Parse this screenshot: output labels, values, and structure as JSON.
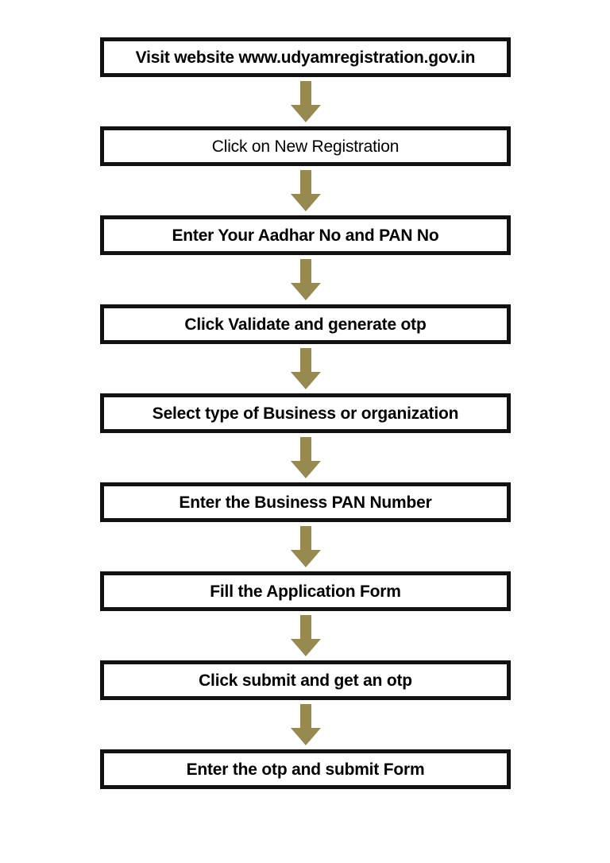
{
  "diagram": {
    "title": "Udyam Registration Process Flowchart",
    "type": "flowchart",
    "orientation": "vertical",
    "background_color": "#ffffff",
    "box_border_color": "#111111",
    "box_fill_color": "#ffffff",
    "text_color": "#000000",
    "arrow_color": "#968a4e",
    "steps": [
      {
        "index": 1,
        "label": "Visit website www.udyamregistration.gov.in",
        "weight": "bold"
      },
      {
        "index": 2,
        "label": "Click on New Registration",
        "weight": "medium"
      },
      {
        "index": 3,
        "label": "Enter Your Aadhar No and PAN No",
        "weight": "bold"
      },
      {
        "index": 4,
        "label": "Click Validate and generate otp",
        "weight": "bold"
      },
      {
        "index": 5,
        "label": "Select type of Business or organization",
        "weight": "bold"
      },
      {
        "index": 6,
        "label": "Enter the Business PAN Number",
        "weight": "bold"
      },
      {
        "index": 7,
        "label": "Fill the Application Form",
        "weight": "bold"
      },
      {
        "index": 8,
        "label": "Click submit and get an otp",
        "weight": "bold"
      },
      {
        "index": 9,
        "label": "Enter the otp and submit Form",
        "weight": "bold"
      }
    ],
    "connectors": [
      {
        "from": 1,
        "to": 2,
        "icon": "down-arrow-icon"
      },
      {
        "from": 2,
        "to": 3,
        "icon": "down-arrow-icon"
      },
      {
        "from": 3,
        "to": 4,
        "icon": "down-arrow-icon"
      },
      {
        "from": 4,
        "to": 5,
        "icon": "down-arrow-icon"
      },
      {
        "from": 5,
        "to": 6,
        "icon": "down-arrow-icon"
      },
      {
        "from": 6,
        "to": 7,
        "icon": "down-arrow-icon"
      },
      {
        "from": 7,
        "to": 8,
        "icon": "down-arrow-icon"
      },
      {
        "from": 8,
        "to": 9,
        "icon": "down-arrow-icon"
      }
    ]
  }
}
